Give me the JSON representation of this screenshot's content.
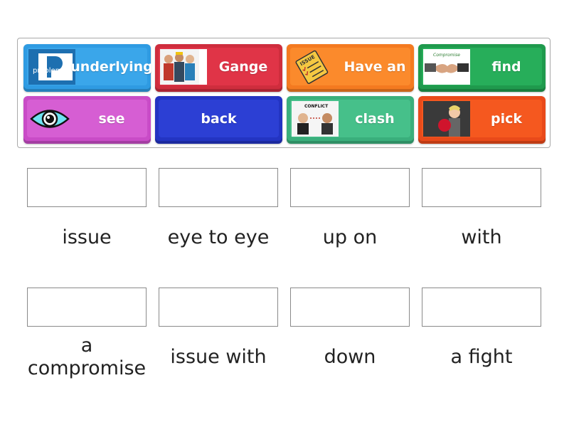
{
  "tiles": [
    {
      "label": "underlying",
      "color": "#2f9be2",
      "inner": "#3aa6ea",
      "icon": "problem-image-icon",
      "icon_text": "problem"
    },
    {
      "label": "Gange",
      "color": "#cf2d3d",
      "inner": "#e03447",
      "icon": "gang-photo-icon"
    },
    {
      "label": "Have an",
      "color": "#f47a20",
      "inner": "#fb8a2c",
      "icon": "checklist-icon",
      "icon_text": "ISSUE"
    },
    {
      "label": "find",
      "color": "#1f9a4d",
      "inner": "#27ae5a",
      "icon": "handshake-icon",
      "icon_text": "Compromise"
    },
    {
      "label": "see",
      "color": "#c94cc7",
      "inner": "#d65ed3",
      "icon": "eye-icon"
    },
    {
      "label": "back",
      "color": "#2334c2",
      "inner": "#2c3fd4",
      "icon": ""
    },
    {
      "label": "clash",
      "color": "#3aaf7c",
      "inner": "#46c08a",
      "icon": "conflict-photo-icon",
      "icon_text": "CONFLICT"
    },
    {
      "label": "pick",
      "color": "#e94a1a",
      "inner": "#f5581f",
      "icon": "boxing-photo-icon"
    }
  ],
  "targets": [
    {
      "word": "issue"
    },
    {
      "word": "eye to eye"
    },
    {
      "word": "up on"
    },
    {
      "word": "with"
    },
    {
      "word": "a compromise"
    },
    {
      "word": "issue with"
    },
    {
      "word": "down"
    },
    {
      "word": "a fight"
    }
  ]
}
